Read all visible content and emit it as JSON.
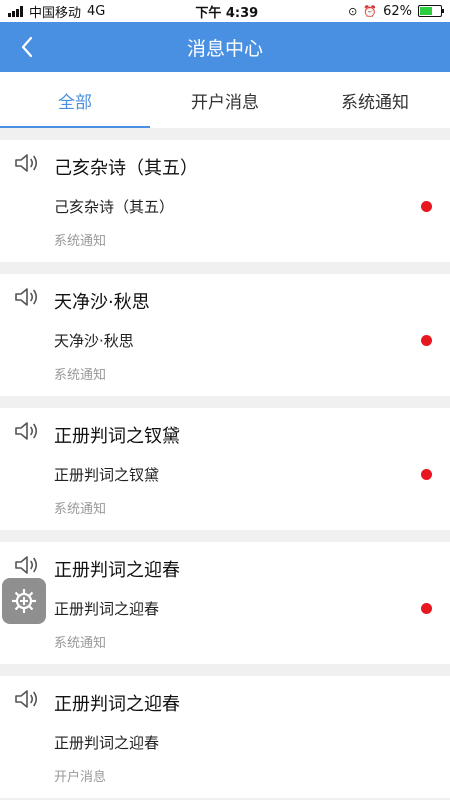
{
  "status_bar": {
    "carrier": "中国移动",
    "network": "4G",
    "time": "下午 4:39",
    "battery": "62%",
    "battery_level": 0.62
  },
  "header": {
    "title": "消息中心",
    "back_icon": "chevron-left-icon"
  },
  "tabs": [
    {
      "label": "全部",
      "active": true
    },
    {
      "label": "开户消息",
      "active": false
    },
    {
      "label": "系统通知",
      "active": false
    }
  ],
  "messages": [
    {
      "title": "己亥杂诗（其五）",
      "content": "己亥杂诗（其五）",
      "category": "系统通知",
      "unread": true
    },
    {
      "title": "天净沙·秋思",
      "content": "天净沙·秋思",
      "category": "系统通知",
      "unread": true
    },
    {
      "title": "正册判词之钗黛",
      "content": "正册判词之钗黛",
      "category": "系统通知",
      "unread": true
    },
    {
      "title": "正册判词之迎春",
      "content": "正册判词之迎春",
      "category": "系统通知",
      "unread": true
    },
    {
      "title": "正册判词之迎春",
      "content": "正册判词之迎春",
      "category": "开户消息",
      "unread": false
    }
  ],
  "colors": {
    "accent": "#4a90e2",
    "unread_dot": "#e8171f",
    "background": "#f0f0f0"
  }
}
